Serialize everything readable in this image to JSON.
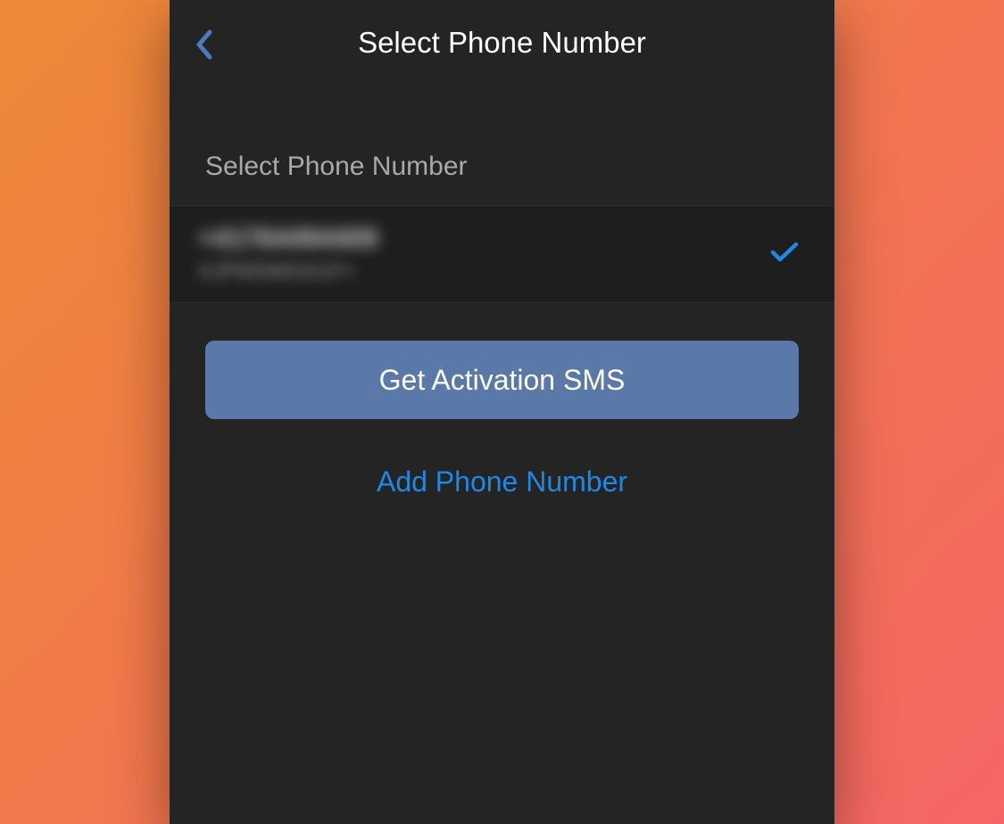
{
  "header": {
    "title": "Select Phone Number"
  },
  "section": {
    "label": "Select Phone Number"
  },
  "phone_list": {
    "items": [
      {
        "number": "+41764494409",
        "label": "XJPMSMOA1F+",
        "selected": true
      }
    ]
  },
  "actions": {
    "primary_label": "Get Activation SMS",
    "add_label": "Add Phone Number"
  },
  "colors": {
    "accent_blue": "#1e88e5",
    "button_blue": "#5a78a8",
    "bg_dark": "#242425",
    "row_dark": "#1e1e1f"
  }
}
